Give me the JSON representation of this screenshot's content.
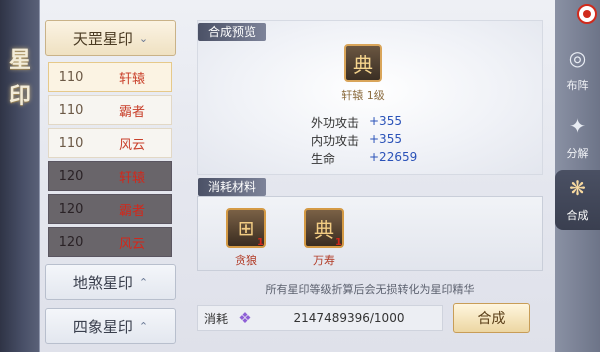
{
  "panel_title": [
    "星",
    "印"
  ],
  "categories": [
    {
      "label": "天罡星印",
      "expanded": true
    },
    {
      "label": "地煞星印",
      "expanded": false
    },
    {
      "label": "四象星印",
      "expanded": false
    }
  ],
  "seal_rows": [
    {
      "level": "110",
      "name": "轩辕"
    },
    {
      "level": "110",
      "name": "霸者"
    },
    {
      "level": "110",
      "name": "风云"
    },
    {
      "level": "120",
      "name": "轩辕"
    },
    {
      "level": "120",
      "name": "霸者"
    },
    {
      "level": "120",
      "name": "风云"
    }
  ],
  "preview": {
    "tag": "合成预览",
    "seal_caption": "轩辕 1级",
    "stats": [
      {
        "label": "外功攻击",
        "value": "+355"
      },
      {
        "label": "内功攻击",
        "value": "+355"
      },
      {
        "label": "生命",
        "value": "+22659"
      }
    ]
  },
  "consume": {
    "tag": "消耗材料",
    "materials": [
      {
        "name": "贪狼",
        "count": "1"
      },
      {
        "name": "万寿",
        "count": "1"
      }
    ]
  },
  "note": "所有星印等级折算后会无损转化为星印精华",
  "cost": {
    "label": "消耗",
    "value": "2147489396/1000",
    "icon": "purple-crystal-icon"
  },
  "combine_button": "合成",
  "right_nav": [
    {
      "label": "布阵",
      "icon": "formation-icon"
    },
    {
      "label": "分解",
      "icon": "decompose-icon"
    },
    {
      "label": "合成",
      "icon": "combine-icon",
      "active": true
    }
  ],
  "colors": {
    "accent_gold": "#d9a55a",
    "stat_blue": "#2a52b8",
    "name_red": "#c9402b"
  }
}
